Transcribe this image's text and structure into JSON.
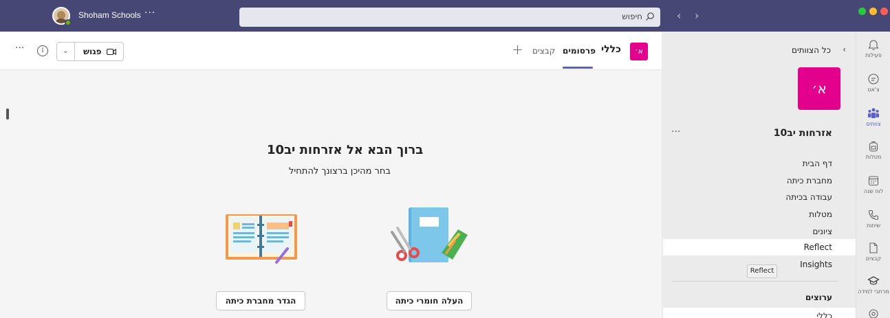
{
  "titlebar": {
    "org_name": "Shoham Schools",
    "more": "···",
    "search_placeholder": "חיפוש",
    "back": "‹",
    "forward": "›"
  },
  "channel": {
    "badge": "א׳",
    "name": "כללי",
    "tabs": [
      "פרסומים",
      "קבצים"
    ],
    "add_tab": "+",
    "meet_label": "פגוש",
    "info": "i",
    "more": "···"
  },
  "welcome": {
    "title": "ברוך הבא אל אזרחות יב10",
    "subtitle": "בחר מהיכן ברצונך להתחיל",
    "upload_button": "העלה חומרי כיתה",
    "notebook_button": "הגדר מחברת כיתה"
  },
  "panel": {
    "all_teams": "כל הצוותים",
    "back_chevron": "‹",
    "team_avatar": "א׳",
    "team_name": "אזרחות יב10",
    "team_more": "···",
    "nav_items": [
      "דף הבית",
      "מחברת כיתה",
      "עבודה בכיתה",
      "מטלות",
      "ציונים",
      "Reflect",
      "Insights"
    ],
    "tooltip": "Reflect",
    "channels_heading": "ערוצים",
    "channel_first": "כללי"
  },
  "rail": {
    "items": [
      {
        "label": "פעילות",
        "icon": "bell-icon"
      },
      {
        "label": "צ'אט",
        "icon": "chat-icon"
      },
      {
        "label": "צוותים",
        "icon": "teams-icon"
      },
      {
        "label": "מטלות",
        "icon": "backpack-icon"
      },
      {
        "label": "לוח שנה",
        "icon": "calendar-icon"
      },
      {
        "label": "שיחות",
        "icon": "phone-icon"
      },
      {
        "label": "קבצים",
        "icon": "file-icon"
      },
      {
        "label": "מרחבי למידה",
        "icon": "graduation-cap-icon"
      }
    ]
  },
  "colors": {
    "titlebar": "#464775",
    "accent": "#5b5fc7",
    "team_badge": "#e3008c",
    "presence": "#6bb700",
    "traffic_green": "#28c840",
    "traffic_yellow": "#febc2e",
    "traffic_red": "#ff5f57"
  }
}
